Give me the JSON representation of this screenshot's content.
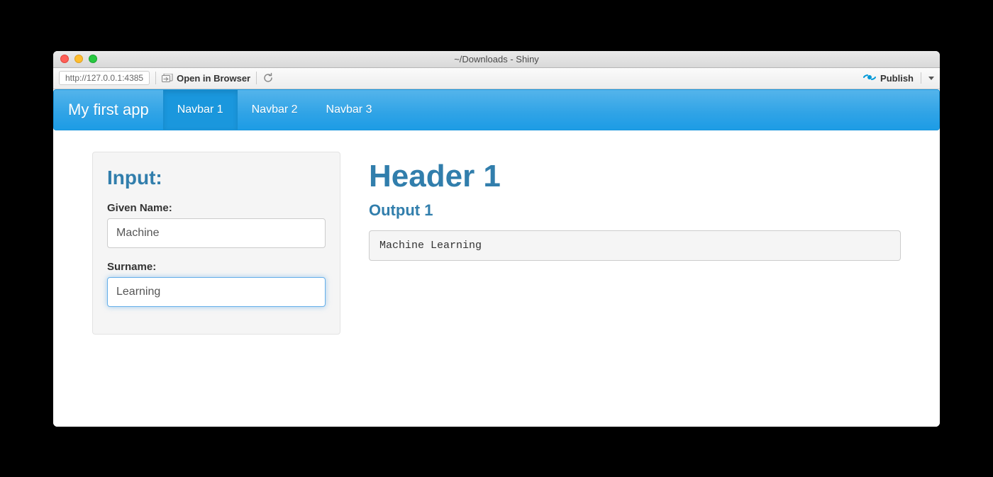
{
  "window": {
    "title": "~/Downloads - Shiny"
  },
  "toolbar": {
    "url": "http://127.0.0.1:4385",
    "open_in_browser": "Open in Browser",
    "publish": "Publish"
  },
  "navbar": {
    "brand": "My first app",
    "tabs": [
      {
        "label": "Navbar 1",
        "active": true
      },
      {
        "label": "Navbar 2",
        "active": false
      },
      {
        "label": "Navbar 3",
        "active": false
      }
    ]
  },
  "sidebar": {
    "title": "Input:",
    "fields": {
      "given_name": {
        "label": "Given Name:",
        "value": "Machine"
      },
      "surname": {
        "label": "Surname:",
        "value": "Learning"
      }
    }
  },
  "main": {
    "header": "Header 1",
    "output_label": "Output 1",
    "output_value": "Machine Learning"
  }
}
